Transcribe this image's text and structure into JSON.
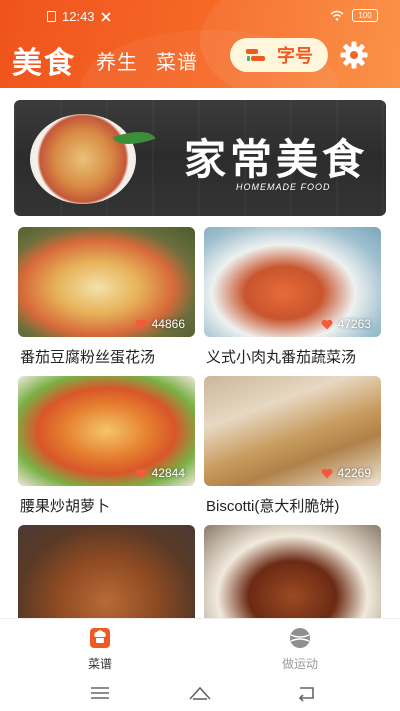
{
  "status_bar": {
    "time": "12:43",
    "battery": "100"
  },
  "header": {
    "tabs": [
      {
        "label": "美食",
        "active": true
      },
      {
        "label": "养生",
        "active": false
      },
      {
        "label": "菜谱",
        "active": false
      }
    ],
    "font_button_label": "字号"
  },
  "banner": {
    "title": "家常美食",
    "subtitle": "HOMEMADE FOOD"
  },
  "recipes": [
    {
      "title": "番茄豆腐粉丝蛋花汤",
      "likes": "44866"
    },
    {
      "title": "义式小肉丸番茄蔬菜汤",
      "likes": "47263"
    },
    {
      "title": "腰果炒胡萝卜",
      "likes": "42844"
    },
    {
      "title": "Biscotti(意大利脆饼)",
      "likes": "42269"
    },
    {
      "title": "",
      "likes": ""
    },
    {
      "title": "",
      "likes": ""
    }
  ],
  "bottom_nav": [
    {
      "label": "菜谱",
      "icon": "chef-hat-icon",
      "active": true
    },
    {
      "label": "做运动",
      "icon": "ball-icon",
      "active": false
    }
  ],
  "colors": {
    "accent": "#f05a22",
    "font_button_bg": "#fff6dc",
    "heart": "#f25a3a"
  }
}
